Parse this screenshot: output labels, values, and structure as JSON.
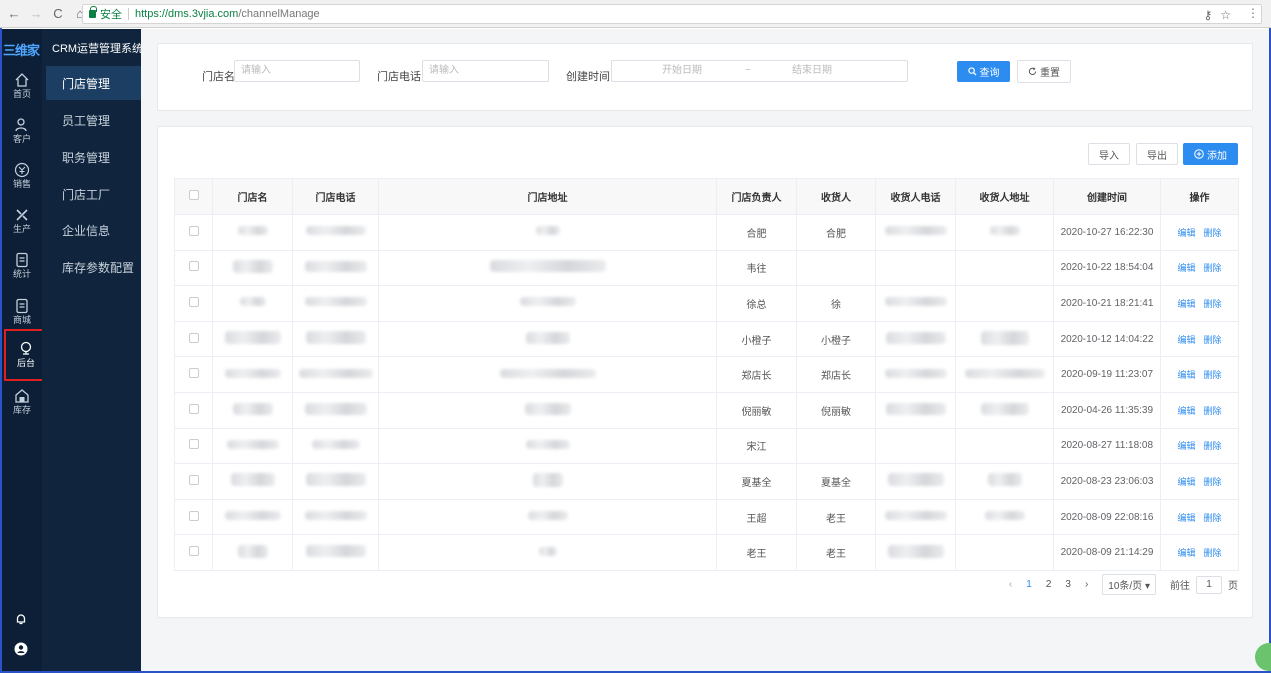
{
  "browser": {
    "secure_label": "安全",
    "url_host": "https://dms.3vjia.com",
    "url_path": "/channelManage"
  },
  "app": {
    "logo": "三维家",
    "system_title": "CRM运营管理系统"
  },
  "rail": [
    {
      "label": "首页",
      "icon": "home-icon"
    },
    {
      "label": "客户",
      "icon": "customer-icon"
    },
    {
      "label": "销售",
      "icon": "sales-icon"
    },
    {
      "label": "生产",
      "icon": "production-icon"
    },
    {
      "label": "统计",
      "icon": "statistics-icon"
    },
    {
      "label": "商城",
      "icon": "mall-icon"
    },
    {
      "label": "后台",
      "icon": "backend-icon"
    },
    {
      "label": "库存",
      "icon": "inventory-icon"
    }
  ],
  "submenu": [
    "门店管理",
    "员工管理",
    "职务管理",
    "门店工厂",
    "企业信息",
    "库存参数配置"
  ],
  "filter": {
    "store_name_label": "门店名:",
    "store_name_placeholder": "请输入",
    "store_phone_label": "门店电话:",
    "store_phone_placeholder": "请输入",
    "created_label": "创建时间:",
    "start_placeholder": "开始日期",
    "range_sep": "~",
    "end_placeholder": "结束日期",
    "query_button": "查询",
    "reset_button": "重置"
  },
  "toolbar": {
    "import_button": "导入",
    "export_button": "导出",
    "add_button": "添加"
  },
  "table": {
    "headers": [
      "门店名",
      "门店电话",
      "门店地址",
      "门店负责人",
      "收货人",
      "收货人电话",
      "收货人地址",
      "创建时间",
      "操作"
    ],
    "edit_label": "编辑",
    "delete_label": "删除",
    "rows": [
      {
        "manager": "合肥",
        "receiver": "合肥",
        "created": "2020-10-27 16:22:30"
      },
      {
        "manager": "韦往",
        "receiver": "",
        "created": "2020-10-22 18:54:04"
      },
      {
        "manager": "徐总",
        "receiver": "徐",
        "created": "2020-10-21 18:21:41"
      },
      {
        "manager": "小橙子",
        "receiver": "小橙子",
        "created": "2020-10-12 14:04:22"
      },
      {
        "manager": "郑店长",
        "receiver": "郑店长",
        "created": "2020-09-19 11:23:07"
      },
      {
        "manager": "倪丽敏",
        "receiver": "倪丽敏",
        "created": "2020-04-26 11:35:39"
      },
      {
        "manager": "宋江",
        "receiver": "",
        "created": "2020-08-27 11:18:08"
      },
      {
        "manager": "夏基全",
        "receiver": "夏基全",
        "created": "2020-08-23 23:06:03"
      },
      {
        "manager": "王超",
        "receiver": "老王",
        "created": "2020-08-09 22:08:16"
      },
      {
        "manager": "老王",
        "receiver": "老王",
        "created": "2020-08-09 21:14:29"
      }
    ]
  },
  "pagination": {
    "pages": [
      "1",
      "2",
      "3"
    ],
    "page_size": "10条/页",
    "goto_label": "前往",
    "goto_value": "1",
    "page_suffix": "页"
  }
}
